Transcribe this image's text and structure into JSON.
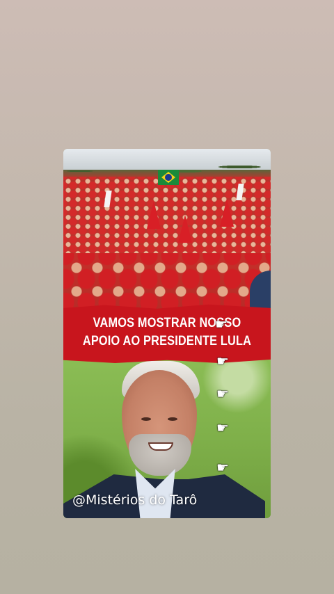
{
  "post": {
    "banner_line1": "VAMOS MOSTRAR NOSSO",
    "banner_line2": "APOIO AO PRESIDENTE LULA",
    "watermark": "@Mistérios do Tarô"
  },
  "icons": {
    "pointer": "pointing-hand-icon",
    "pointer_glyph": "☛"
  },
  "colors": {
    "banner_red": "#c8151d",
    "background": "#c3b8ad"
  }
}
